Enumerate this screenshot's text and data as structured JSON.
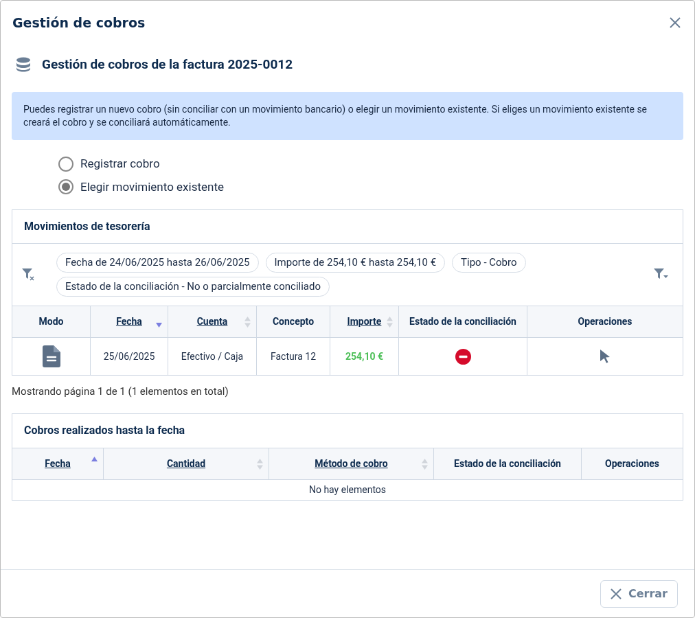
{
  "dialog": {
    "title": "Gestión de cobros"
  },
  "heading": "Gestión de cobros de la factura 2025-0012",
  "info": "Puedes registrar un nuevo cobro (sin conciliar con un movimiento bancario) o elegir un movimiento existente. Si eliges un movimiento existente se creará el cobro y se conciliará automáticamente.",
  "options": [
    {
      "label": "Registrar cobro",
      "selected": false
    },
    {
      "label": "Elegir movimiento existente",
      "selected": true
    }
  ],
  "movements": {
    "title": "Movimientos de tesorería",
    "filters": [
      "Fecha de 24/06/2025 hasta 26/06/2025",
      "Importe de 254,10 € hasta 254,10 €",
      "Tipo - Cobro",
      "Estado de la conciliación - No o parcialmente conciliado"
    ],
    "columns": [
      {
        "label": "Modo",
        "kind": "plain"
      },
      {
        "label": "Fecha",
        "kind": "sorted_desc"
      },
      {
        "label": "Cuenta",
        "kind": "sortable"
      },
      {
        "label": "Concepto",
        "kind": "plain"
      },
      {
        "label": "Importe",
        "kind": "sortable"
      },
      {
        "label": "Estado de la conciliación",
        "kind": "plain"
      },
      {
        "label": "Operaciones",
        "kind": "plain"
      }
    ],
    "rows": [
      {
        "kind": "document",
        "date": "25/06/2025",
        "account": "Efectivo / Caja",
        "concept": "Factura 12",
        "amount": "254,10 €",
        "reconciled": false
      }
    ],
    "pagination": "Mostrando página 1 de 1 (1 elementos en total)"
  },
  "payments": {
    "title": "Cobros realizados hasta la fecha",
    "columns": [
      {
        "label": "Fecha",
        "kind": "sorted_asc"
      },
      {
        "label": "Cantidad",
        "kind": "sortable"
      },
      {
        "label": "Método de cobro",
        "kind": "sortable"
      },
      {
        "label": "Estado de la conciliación",
        "kind": "plain"
      },
      {
        "label": "Operaciones",
        "kind": "plain"
      }
    ],
    "empty": "No hay elementos"
  },
  "footer": {
    "close": "Cerrar"
  }
}
